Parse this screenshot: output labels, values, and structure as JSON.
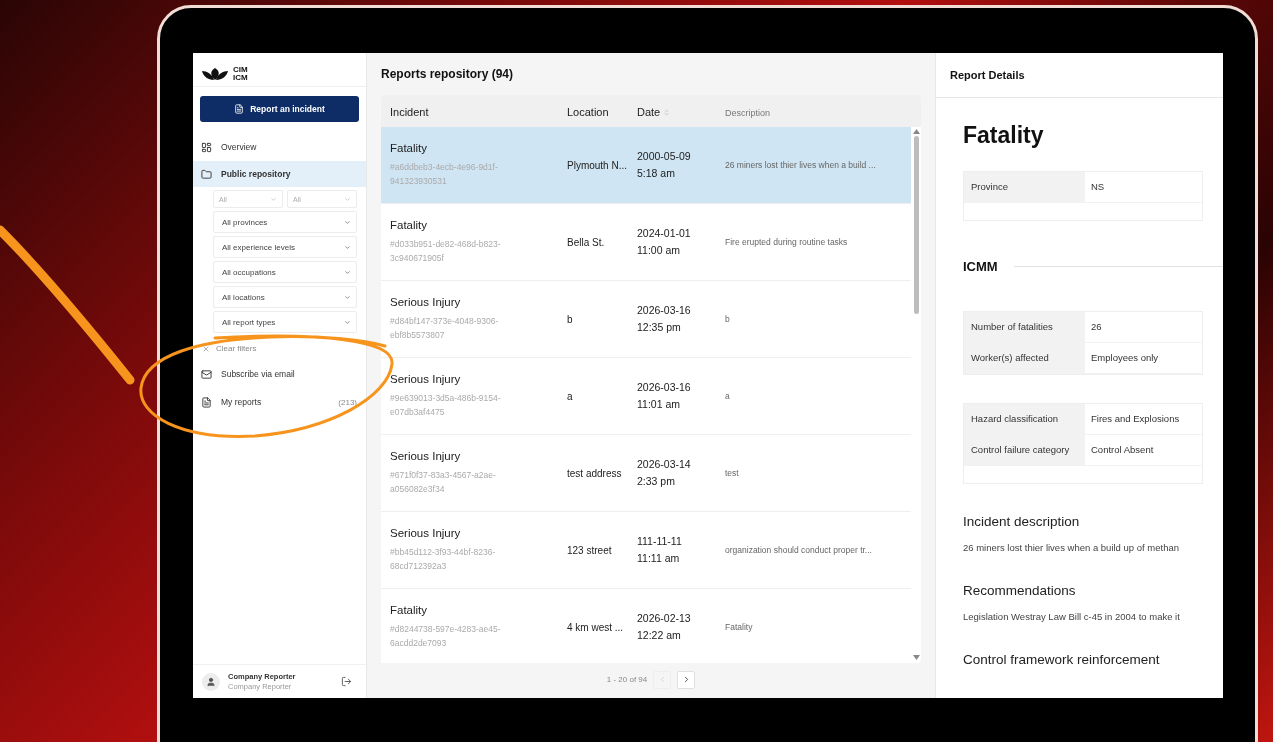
{
  "sidebar": {
    "logo": [
      "CIM",
      "ICM"
    ],
    "report_button": "Report an incident",
    "nav": [
      {
        "label": "Overview",
        "selected": false
      },
      {
        "label": "Public repository",
        "selected": true
      }
    ],
    "filter_pair": [
      "All",
      "All"
    ],
    "filters": [
      "All provinces",
      "All experience levels",
      "All occupations",
      "All locations",
      "All report types"
    ],
    "clear_filters": "Clear filters",
    "links": [
      {
        "label": "Subscribe via email"
      },
      {
        "label": "My reports",
        "count": "(213)"
      }
    ],
    "user": {
      "name": "Company Reporter",
      "role": "Company Reporter"
    }
  },
  "repository": {
    "title": "Reports repository (94)",
    "columns": [
      {
        "label": "Incident",
        "sortable": false,
        "muted": false
      },
      {
        "label": "Location",
        "sortable": false,
        "muted": false
      },
      {
        "label": "Date",
        "sortable": true,
        "muted": false
      },
      {
        "label": "Description",
        "sortable": false,
        "muted": true
      }
    ],
    "rows": [
      {
        "type": "Fatality",
        "id": "#a6ddbeb3-4ecb-4e96-9d1f-941323930531",
        "location": "Plymouth N...",
        "date": "2000-05-09",
        "time": "5:18 am",
        "description": "26 miners lost thier lives when a build ...",
        "selected": true
      },
      {
        "type": "Fatality",
        "id": "#d033b951-de82-468d-b823-3c940671905f",
        "location": "Bella St.",
        "date": "2024-01-01",
        "time": "11:00 am",
        "description": "Fire erupted during routine tasks",
        "selected": false
      },
      {
        "type": "Serious Injury",
        "id": "#d84bf147-373e-4048-9306-ebf8b5573807",
        "location": "b",
        "date": "2026-03-16",
        "time": "12:35 pm",
        "description": "b",
        "selected": false
      },
      {
        "type": "Serious Injury",
        "id": "#9e639013-3d5a-486b-9154-e07db3af4475",
        "location": "a",
        "date": "2026-03-16",
        "time": "11:01 am",
        "description": "a",
        "selected": false
      },
      {
        "type": "Serious Injury",
        "id": "#671f0f37-83a3-4567-a2ae-a056082e3f34",
        "location": "test address",
        "date": "2026-03-14",
        "time": "2:33 pm",
        "description": "test",
        "selected": false
      },
      {
        "type": "Serious Injury",
        "id": "#bb45d112-3f93-44bf-8236-68cd712392a3",
        "location": "123 street",
        "date": "111-11-11",
        "time": "11:11 am",
        "description": "organization should conduct proper tr...",
        "selected": false
      },
      {
        "type": "Fatality",
        "id": "#d8244738-597e-4283-ae45-6acdd2de7093",
        "location": "4 km west ...",
        "date": "2026-02-13",
        "time": "12:22 am",
        "description": "Fatality",
        "selected": false
      }
    ],
    "pagination": {
      "range": "1 - 20 of 94",
      "prev_disabled": true,
      "next_disabled": false
    }
  },
  "details": {
    "title": "Report Details",
    "heading": "Fatality",
    "province_table": [
      {
        "label": "Province",
        "value": "NS"
      }
    ],
    "section": "ICMM",
    "tables": [
      [
        {
          "label": "Number of fatalities",
          "value": "26"
        },
        {
          "label": "Worker(s) affected",
          "value": "Employees only"
        }
      ],
      [
        {
          "label": "Hazard classification",
          "value": "Fires and Explosions"
        },
        {
          "label": "Control failure category",
          "value": "Control Absent"
        }
      ]
    ],
    "blocks": [
      {
        "heading": "Incident description",
        "text": "26 miners lost thier lives when a build up of methan"
      },
      {
        "heading": "Recommendations",
        "text": "Legislation Westray Law Bill c-45 in 2004 to make it"
      },
      {
        "heading": "Control framework reinforcement"
      }
    ]
  }
}
